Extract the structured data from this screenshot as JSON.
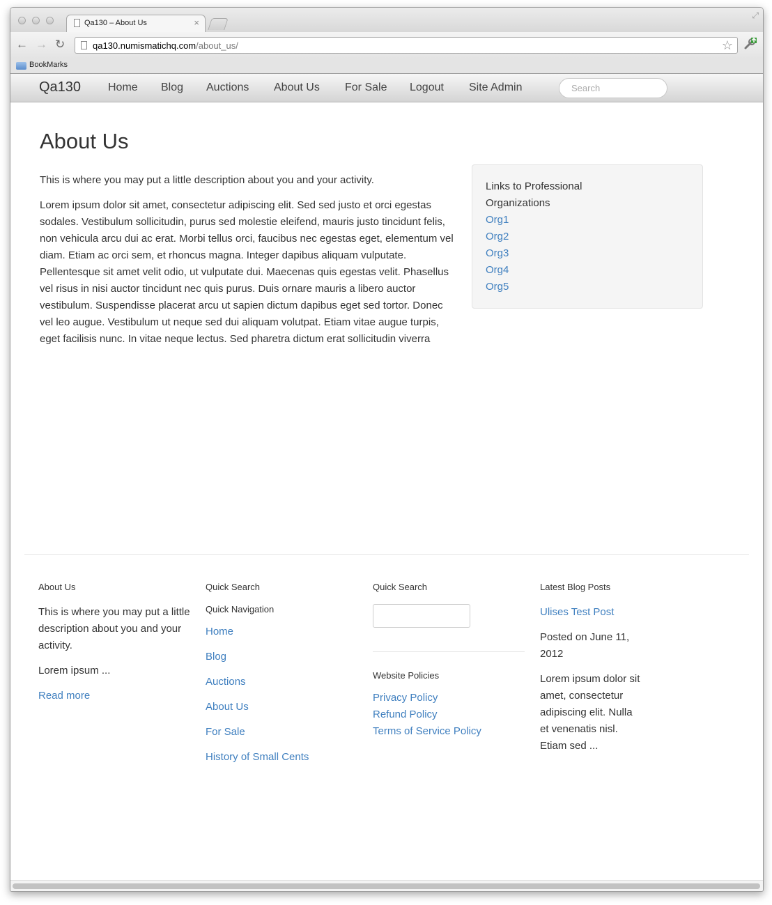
{
  "browser": {
    "tab_title": "Qa130 – About Us",
    "tab_close": "×",
    "url_host": "qa130.numismatichq.com",
    "url_path": "/about_us/",
    "bookmark_folder": "BookMarks"
  },
  "nav": {
    "brand": "Qa130",
    "links": [
      "Home",
      "Blog",
      "Auctions",
      "About Us",
      "For Sale",
      "Logout",
      "Site Admin"
    ],
    "search_placeholder": "Search"
  },
  "main": {
    "title": "About Us",
    "intro": "This is where you may put a little description about you and your activity.",
    "body": "Lorem ipsum dolor sit amet, consectetur adipiscing elit. Sed sed justo et orci egestas sodales. Vestibulum sollicitudin, purus sed molestie eleifend, mauris justo tincidunt felis, non vehicula arcu dui ac erat. Morbi tellus orci, faucibus nec egestas eget, elementum vel diam. Etiam ac orci sem, et rhoncus magna. Integer dapibus aliquam vulputate. Pellentesque sit amet velit odio, ut vulputate dui. Maecenas quis egestas velit. Phasellus vel risus in nisi auctor tincidunt nec quis purus. Duis ornare mauris a libero auctor vestibulum. Suspendisse placerat arcu ut sapien dictum dapibus eget sed tortor. Donec vel leo augue. Vestibulum ut neque sed dui aliquam volutpat. Etiam vitae augue turpis, eget facilisis nunc. In vitae neque lectus. Sed pharetra dictum erat sollicitudin viverra"
  },
  "sidebar": {
    "title": "Links to Professional Organizations",
    "links": [
      "Org1",
      "Org2",
      "Org3",
      "Org4",
      "Org5"
    ]
  },
  "footer": {
    "about": {
      "heading": "About Us",
      "text": "This is where you may put a little description about you and your activity.",
      "excerpt": "Lorem ipsum ...",
      "read_more": "Read more"
    },
    "nav": {
      "heading": "Quick Search",
      "subheading": "Quick Navigation",
      "links": [
        "Home",
        "Blog",
        "Auctions",
        "About Us",
        "For Sale",
        "History of Small Cents"
      ]
    },
    "search": {
      "heading": "Quick Search",
      "policies_heading": "Website Policies",
      "policies": [
        "Privacy Policy",
        "Refund Policy",
        "Terms of Service Policy"
      ]
    },
    "blog": {
      "heading": "Latest Blog Posts",
      "post_title": "Ulises Test Post",
      "posted": "Posted on June 11, 2012",
      "excerpt": "Lorem ipsum dolor sit amet, consectetur adipiscing elit. Nulla et venenatis nisl. Etiam sed ..."
    }
  },
  "colors": {
    "link": "#3f7fbf",
    "text": "#333333",
    "well": "#f5f5f5"
  }
}
